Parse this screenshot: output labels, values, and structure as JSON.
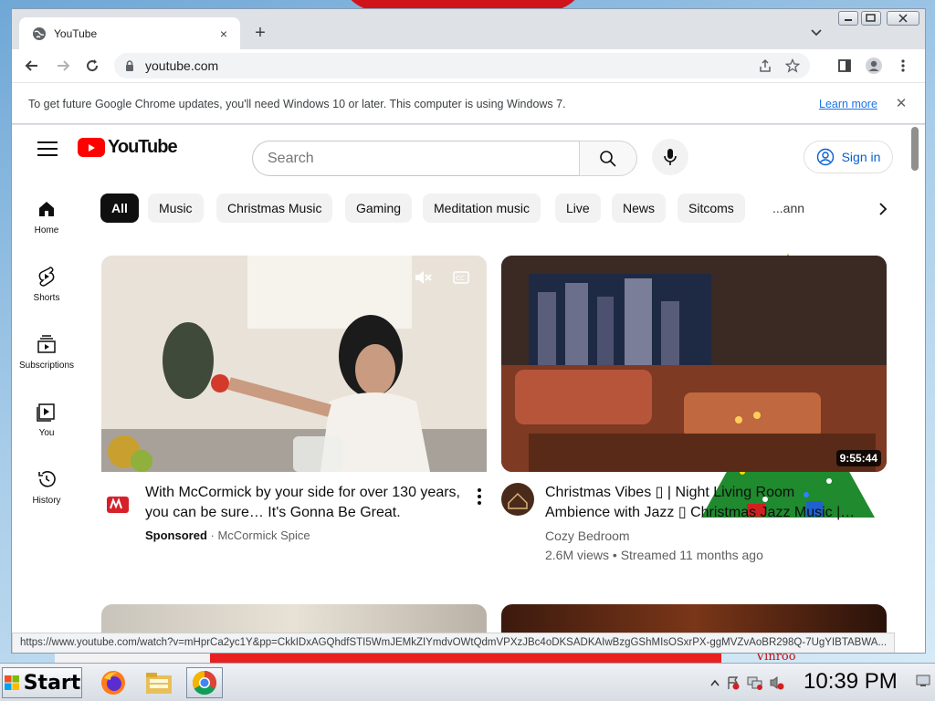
{
  "browser": {
    "tab_title": "YouTube",
    "tab_close": "×",
    "new_tab": "+",
    "url": "youtube.com"
  },
  "infobar": {
    "message": "To get future Google Chrome updates, you'll need Windows 10 or later. This computer is using Windows 7.",
    "link": "Learn more",
    "close": "✕"
  },
  "youtube": {
    "logo_text": "YouTube",
    "search_placeholder": "Search",
    "sign_in": "Sign in",
    "sidebar": [
      {
        "label": "Home",
        "icon": "home-icon"
      },
      {
        "label": "Shorts",
        "icon": "shorts-icon"
      },
      {
        "label": "Subscriptions",
        "icon": "subscriptions-icon"
      },
      {
        "label": "You",
        "icon": "you-icon"
      },
      {
        "label": "History",
        "icon": "history-icon"
      }
    ],
    "chips": [
      "All",
      "Music",
      "Christmas Music",
      "Gaming",
      "Meditation music",
      "Live",
      "News",
      "Sitcoms",
      "...ann"
    ],
    "videos": [
      {
        "title": "With McCormick by your side for over 130 years, you can be sure… It's Gonna Be Great.",
        "sponsored": "Sponsored",
        "separator": " · ",
        "channel": "McCormick Spice"
      },
      {
        "title": "Christmas Vibes ▯ | Night Living Room Ambience with Jazz ▯ Christmas Jazz Music |…",
        "channel": "Cozy Bedroom",
        "meta": "2.6M views • Streamed 11 months ago",
        "duration": "9:55:44"
      }
    ]
  },
  "status_url": "https://www.youtube.com/watch?v=mHprCa2yc1Y&pp=CkkIDxAGQhdfSTI5WmJEMkZIYmdvOWtQdmVPXzJBc4oDKSADKAIwBzgGShMIsOSxrPX-ggMVZvAoBR298Q-7UgYIBTABWA...",
  "taskbar": {
    "start_label": "Start",
    "clock": "10:39 PM"
  },
  "desktop": {
    "bottom_text": "Vinroo"
  },
  "colors": {
    "yt_red": "#ff0000",
    "link_blue": "#065fd4",
    "chrome_frame": "#dee1e6"
  }
}
